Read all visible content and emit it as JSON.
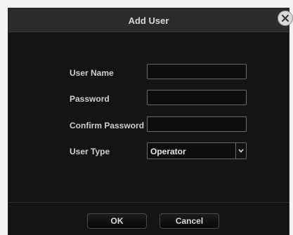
{
  "dialog": {
    "title": "Add User",
    "close_icon": "close-icon"
  },
  "form": {
    "username": {
      "label": "User Name",
      "value": ""
    },
    "password": {
      "label": "Password",
      "value": ""
    },
    "confirm_password": {
      "label": "Confirm Password",
      "value": ""
    },
    "user_type": {
      "label": "User Type",
      "selected": "Operator",
      "icon": "chevron-down-icon"
    }
  },
  "buttons": {
    "ok_label": "OK",
    "cancel_label": "Cancel"
  }
}
